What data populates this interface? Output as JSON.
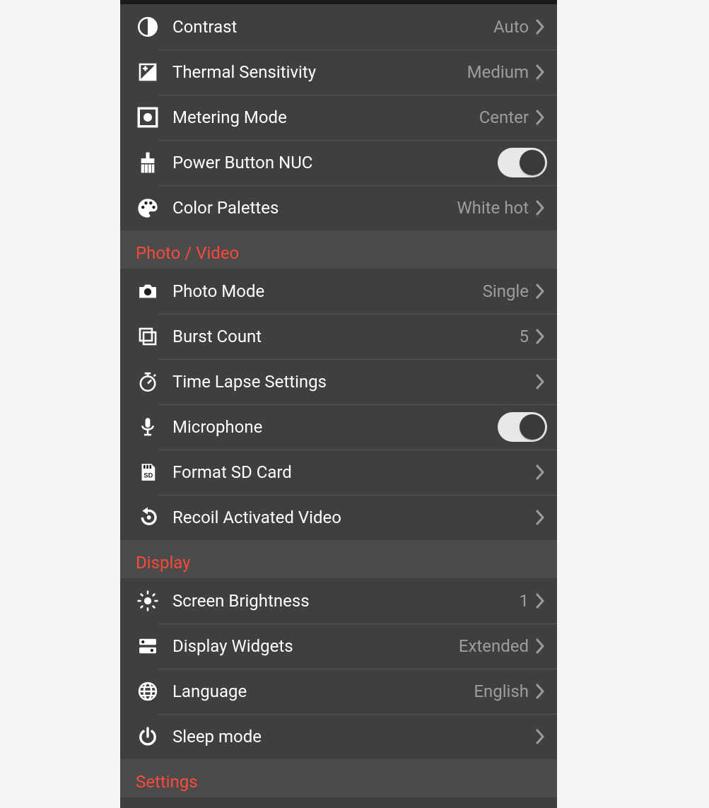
{
  "groups": [
    {
      "header": null,
      "rows": [
        {
          "id": "contrast",
          "icon": "contrast-icon",
          "label": "Contrast",
          "value": "Auto",
          "control": "disclosure"
        },
        {
          "id": "thermal-sensitivity",
          "icon": "exposure-icon",
          "label": "Thermal Sensitivity",
          "value": "Medium",
          "control": "disclosure"
        },
        {
          "id": "metering-mode",
          "icon": "metering-icon",
          "label": "Metering Mode",
          "value": "Center",
          "control": "disclosure"
        },
        {
          "id": "power-button-nuc",
          "icon": "brush-icon",
          "label": "Power Button NUC",
          "value": null,
          "control": "toggle",
          "toggleOn": true
        },
        {
          "id": "color-palettes",
          "icon": "palette-icon",
          "label": "Color Palettes",
          "value": "White hot",
          "control": "disclosure"
        }
      ]
    },
    {
      "header": "Photo / Video",
      "rows": [
        {
          "id": "photo-mode",
          "icon": "camera-icon",
          "label": "Photo Mode",
          "value": "Single",
          "control": "disclosure"
        },
        {
          "id": "burst-count",
          "icon": "burst-icon",
          "label": "Burst Count",
          "value": "5",
          "control": "disclosure"
        },
        {
          "id": "time-lapse",
          "icon": "stopwatch-icon",
          "label": "Time Lapse Settings",
          "value": null,
          "control": "disclosure"
        },
        {
          "id": "microphone",
          "icon": "microphone-icon",
          "label": "Microphone",
          "value": null,
          "control": "toggle",
          "toggleOn": true
        },
        {
          "id": "format-sd",
          "icon": "sdcard-icon",
          "label": "Format SD Card",
          "value": null,
          "control": "disclosure"
        },
        {
          "id": "recoil-video",
          "icon": "undo-icon",
          "label": "Recoil Activated Video",
          "value": null,
          "control": "disclosure"
        }
      ]
    },
    {
      "header": "Display",
      "rows": [
        {
          "id": "screen-brightness",
          "icon": "brightness-icon",
          "label": "Screen Brightness",
          "value": "1",
          "control": "disclosure"
        },
        {
          "id": "display-widgets",
          "icon": "widgets-icon",
          "label": "Display Widgets",
          "value": "Extended",
          "control": "disclosure"
        },
        {
          "id": "language",
          "icon": "globe-icon",
          "label": "Language",
          "value": "English",
          "control": "disclosure"
        },
        {
          "id": "sleep-mode",
          "icon": "power-icon",
          "label": "Sleep mode",
          "value": null,
          "control": "disclosure"
        }
      ]
    },
    {
      "header": "Settings",
      "rows": []
    }
  ]
}
